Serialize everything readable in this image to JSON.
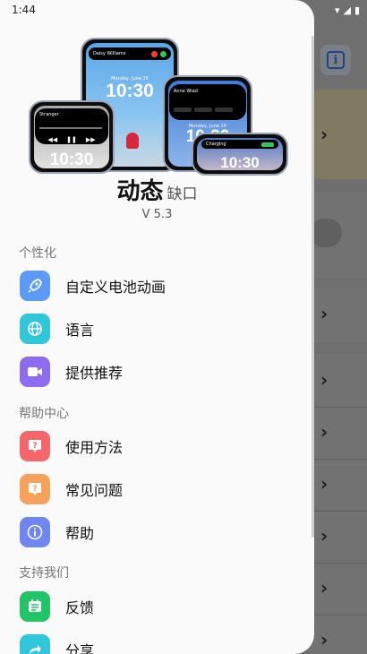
{
  "status_bar": {
    "time": "1:44"
  },
  "app": {
    "title": "动态",
    "subtitle": "缺口",
    "version": "V 5.3"
  },
  "hero": {
    "phone1": {
      "caller": "Daisy Williams",
      "clock": "10:30",
      "date": "Monday, June 15"
    },
    "phone2": {
      "clock": "10:30",
      "date": "Monday, June 15",
      "sender": "Anne Wiad"
    },
    "phone3": {
      "track": "Stranger",
      "clock": "10:30"
    },
    "phone4": {
      "label": "Charging",
      "clock": "10:30"
    }
  },
  "menu": {
    "sections": [
      {
        "title": "个性化",
        "items": [
          {
            "label": "自定义电池动画",
            "icon": "rocket-icon",
            "color": "#5b9bf5"
          },
          {
            "label": "语言",
            "icon": "globe-icon",
            "color": "#2fc7d9"
          },
          {
            "label": "提供推荐",
            "icon": "video-icon",
            "color": "#8e6cf0"
          }
        ]
      },
      {
        "title": "帮助中心",
        "items": [
          {
            "label": "使用方法",
            "icon": "question-bubble-icon",
            "color": "#f4666a"
          },
          {
            "label": "常见问题",
            "icon": "question-bubble-icon",
            "color": "#f7a25b"
          },
          {
            "label": "帮助",
            "icon": "info-icon",
            "color": "#6f86f0"
          }
        ]
      },
      {
        "title": "支持我们",
        "items": [
          {
            "label": "反馈",
            "icon": "feedback-icon",
            "color": "#22c468"
          },
          {
            "label": "分享",
            "icon": "share-icon",
            "color": "#2fc7d9"
          }
        ]
      }
    ]
  }
}
